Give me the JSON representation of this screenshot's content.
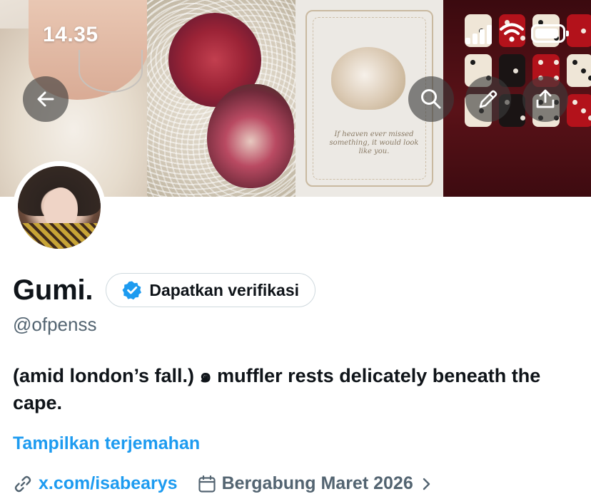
{
  "status_bar": {
    "time": "14.35"
  },
  "banner": {
    "quote_text": "If heaven ever missed something, it would look like you."
  },
  "toolbar": {
    "back_icon": "arrow-left-icon",
    "search_icon": "search-icon",
    "edit_icon": "pencil-icon",
    "share_icon": "share-icon"
  },
  "profile": {
    "display_name": "Gumi.",
    "verify_button_label": "Dapatkan verifikasi",
    "handle": "@ofpenss",
    "bio": "(amid london’s fall.) ๑ muffler rests delicately beneath the cape.",
    "translate_label": "Tampilkan terjemahan",
    "website": "x.com/isabearys",
    "joined": "Bergabung Maret 2026"
  },
  "colors": {
    "accent": "#1d9bf0",
    "secondary_text": "#536471",
    "primary_text": "#0f1419",
    "border": "#cfd9de"
  }
}
